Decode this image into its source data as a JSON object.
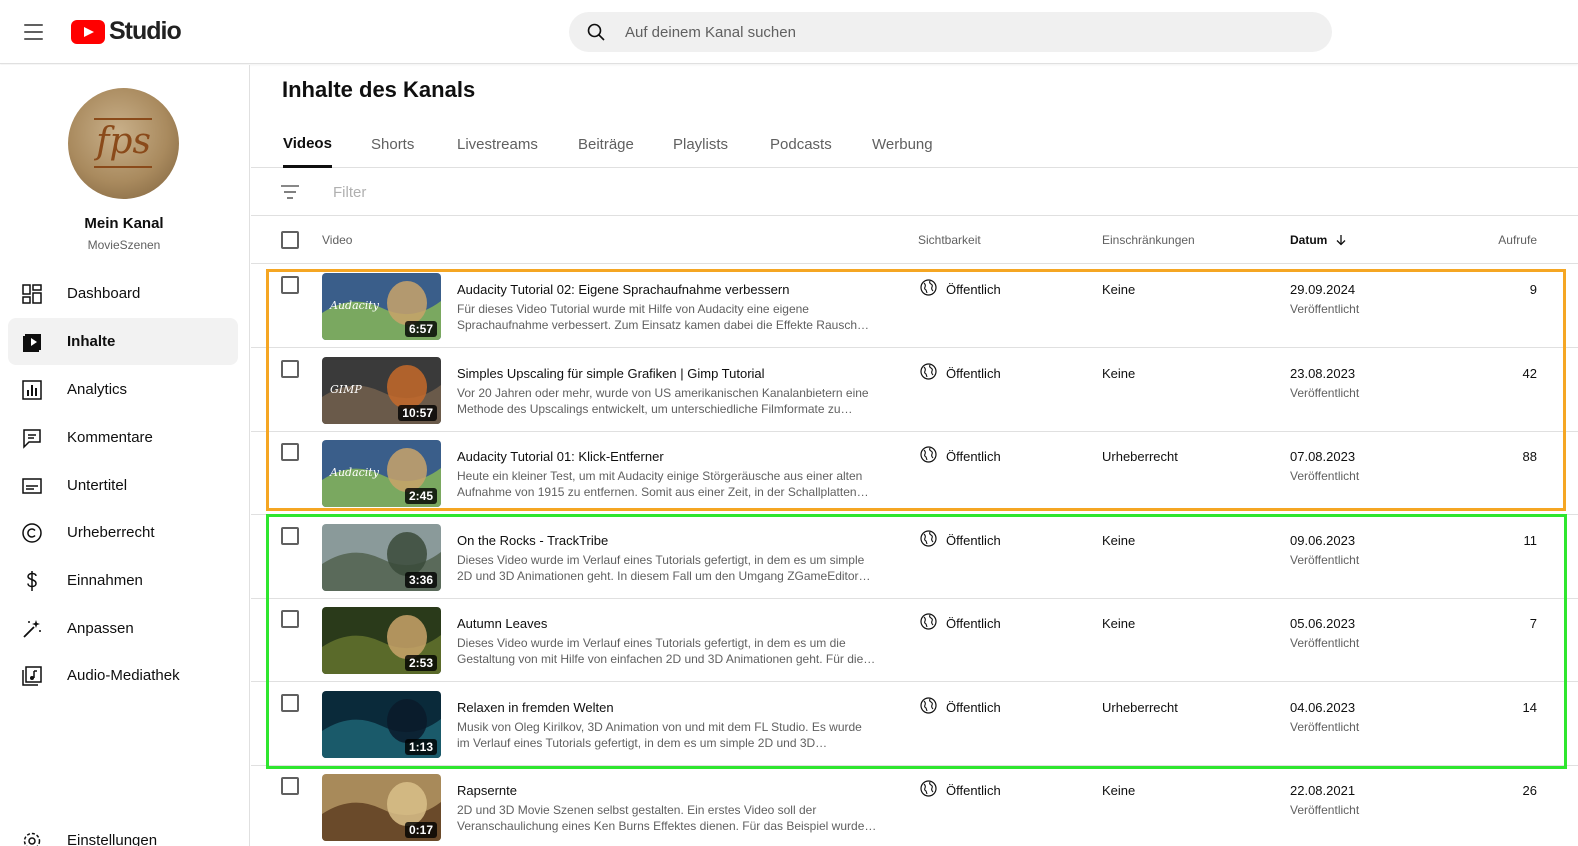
{
  "app": {
    "logo_text": "Studio",
    "brand_color": "#ff0000"
  },
  "search": {
    "placeholder": "Auf deinem Kanal suchen"
  },
  "channel": {
    "name": "Mein Kanal",
    "handle": "MovieSzenen",
    "avatar_text": "fps"
  },
  "sidebar": {
    "items": [
      {
        "label": "Dashboard",
        "icon": "dashboard-icon"
      },
      {
        "label": "Inhalte",
        "icon": "content-icon",
        "active": true
      },
      {
        "label": "Analytics",
        "icon": "analytics-icon"
      },
      {
        "label": "Kommentare",
        "icon": "comments-icon"
      },
      {
        "label": "Untertitel",
        "icon": "subtitles-icon"
      },
      {
        "label": "Urheberrecht",
        "icon": "copyright-icon"
      },
      {
        "label": "Einnahmen",
        "icon": "dollar-icon"
      },
      {
        "label": "Anpassen",
        "icon": "magic-wand-icon"
      },
      {
        "label": "Audio-Mediathek",
        "icon": "audio-library-icon"
      },
      {
        "label": "Einstellungen",
        "icon": "settings-icon"
      }
    ]
  },
  "main": {
    "title": "Inhalte des Kanals",
    "tabs": [
      {
        "label": "Videos",
        "active": true
      },
      {
        "label": "Shorts"
      },
      {
        "label": "Livestreams"
      },
      {
        "label": "Beiträge"
      },
      {
        "label": "Playlists"
      },
      {
        "label": "Podcasts"
      },
      {
        "label": "Werbung"
      }
    ],
    "filter_placeholder": "Filter",
    "columns": {
      "video": "Video",
      "visibility": "Sichtbarkeit",
      "restrictions": "Einschränkungen",
      "date": "Datum",
      "date_sort_icon": "arrow-down-icon",
      "views": "Aufrufe"
    },
    "videos": [
      {
        "title": "Audacity Tutorial 02: Eigene Sprachaufnahme verbessern",
        "desc1": "Für dieses Video Tutorial wurde mit Hilfe von Audacity eine eigene",
        "desc2": "Sprachaufnahme verbessert. Zum Einsatz kamen dabei die Effekte Rausch…",
        "duration": "6:57",
        "thumb_text": "Audacity",
        "thumb_colors": [
          "#3a5e8a",
          "#7aa860",
          "#c9a36a"
        ],
        "visibility": "Öffentlich",
        "restrictions": "Keine",
        "date": "29.09.2024",
        "status": "Veröffentlicht",
        "views": "9"
      },
      {
        "title": "Simples Upscaling für simple Grafiken | Gimp Tutorial",
        "desc1": "Vor 20 Jahren oder mehr, wurde von US amerikanischen Kanalanbietern eine",
        "desc2": "Methode des Upscalings entwickelt, um unterschiedliche Filmformate zu…",
        "duration": "10:57",
        "thumb_text": "GIMP",
        "thumb_colors": [
          "#3a3a3a",
          "#6a5a4a",
          "#c66a2a"
        ],
        "visibility": "Öffentlich",
        "restrictions": "Keine",
        "date": "23.08.2023",
        "status": "Veröffentlicht",
        "views": "42"
      },
      {
        "title": "Audacity Tutorial 01: Klick-Entferner",
        "desc1": "Heute ein kleiner Test, um mit Audacity einige Störgeräusche aus einer alten",
        "desc2": "Aufnahme von 1915 zu entfernen. Somit aus einer Zeit, in der Schallplatten…",
        "duration": "2:45",
        "thumb_text": "Audacity",
        "thumb_colors": [
          "#3a5e8a",
          "#7aa860",
          "#c9a36a"
        ],
        "visibility": "Öffentlich",
        "restrictions": "Urheberrecht",
        "date": "07.08.2023",
        "status": "Veröffentlicht",
        "views": "88"
      },
      {
        "title": "On the Rocks - TrackTribe",
        "desc1": "Dieses Video wurde im Verlauf eines Tutorials gefertigt, in dem es um simple",
        "desc2": "2D und 3D Animationen geht. In diesem Fall um den Umgang ZGameEditor…",
        "duration": "3:36",
        "thumb_text": "",
        "thumb_colors": [
          "#8a9a9a",
          "#5a6a5a",
          "#3a4a3a"
        ],
        "visibility": "Öffentlich",
        "restrictions": "Keine",
        "date": "09.06.2023",
        "status": "Veröffentlicht",
        "views": "11"
      },
      {
        "title": "Autumn Leaves",
        "desc1": "Dieses Video wurde im Verlauf eines Tutorials gefertigt, in dem es um die",
        "desc2": "Gestaltung von mit Hilfe von einfachen 2D und 3D Animationen geht. Für die…",
        "duration": "2:53",
        "thumb_text": "",
        "thumb_colors": [
          "#2a3a1a",
          "#5a6a2a",
          "#c9a36a"
        ],
        "visibility": "Öffentlich",
        "restrictions": "Keine",
        "date": "05.06.2023",
        "status": "Veröffentlicht",
        "views": "7"
      },
      {
        "title": "Relaxen in fremden Welten",
        "desc1": "Musik von Oleg Kirilkov, 3D Animation von und mit dem FL Studio. Es wurde",
        "desc2": "im Verlauf eines Tutorials gefertigt, in dem es um simple 2D und 3D…",
        "duration": "1:13",
        "thumb_text": "",
        "thumb_colors": [
          "#0a2a3a",
          "#1a5a6a",
          "#0a1a2a"
        ],
        "visibility": "Öffentlich",
        "restrictions": "Urheberrecht",
        "date": "04.06.2023",
        "status": "Veröffentlicht",
        "views": "14"
      },
      {
        "title": "Rapsernte",
        "desc1": "2D und 3D Movie Szenen selbst gestalten. Ein erstes Video soll der",
        "desc2": "Veranschaulichung eines Ken Burns Effektes dienen. Für das Beispiel wurde…",
        "duration": "0:17",
        "thumb_text": "",
        "thumb_colors": [
          "#a88a5a",
          "#6a4a2a",
          "#d9c08a"
        ],
        "visibility": "Öffentlich",
        "restrictions": "Keine",
        "date": "22.08.2021",
        "status": "Veröffentlicht",
        "views": "26"
      }
    ]
  },
  "highlights": {
    "orange": "#f5a623",
    "green": "#2ee62e"
  }
}
